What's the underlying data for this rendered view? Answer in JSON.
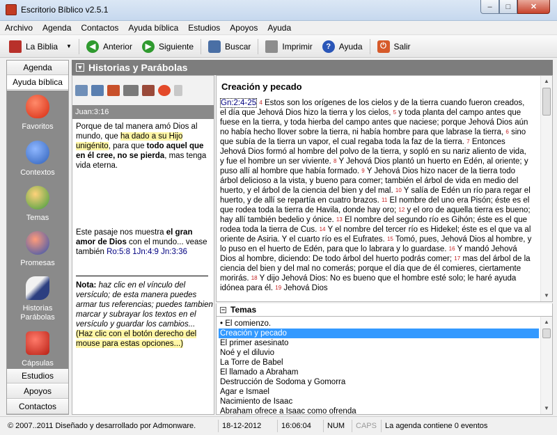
{
  "window": {
    "title": "Escritorio Bíblico v2.5.1",
    "min_glyph": "–",
    "max_glyph": "□",
    "close_glyph": "✕"
  },
  "menu": [
    "Archivo",
    "Agenda",
    "Contactos",
    "Ayuda bíblica",
    "Estudios",
    "Apoyos",
    "Ayuda"
  ],
  "toolbar": {
    "bible": "La Biblia",
    "back": "Anterior",
    "next": "Siguiente",
    "search": "Buscar",
    "print": "Imprimir",
    "help": "Ayuda",
    "exit": "Salir",
    "dropdown_glyph": "▼"
  },
  "leftnav": {
    "top_buttons": [
      "Agenda",
      "Ayuda bíblica"
    ],
    "items": [
      "Favoritos",
      "Contextos",
      "Temas",
      "Promesas",
      "Historias Parábolas",
      "Cápsulas"
    ],
    "bottom_buttons": [
      "Estudios",
      "Apoyos",
      "Contactos"
    ],
    "scroll_glyph": "▼"
  },
  "section": {
    "title": "Historias y Parábolas",
    "chevron": "▼"
  },
  "verse": {
    "ref": "Juan:3:16",
    "t1": "Porque de tal manera amó Dios al mundo, que ",
    "h1": "ha dado a su Hijo unigénito",
    "t2": ", para que ",
    "b1": "todo aquel que en él cree, no se pierda",
    "t3": ", mas tenga vida eterna."
  },
  "note": {
    "t1": "Este pasaje nos muestra ",
    "b1": "el gran amor de Dios",
    "t2": " con el mundo... vease también ",
    "l1": "Ro:5:8",
    "l2": "1Jn:4:9",
    "l3": "Jn:3:36"
  },
  "tip": {
    "label": "Nota:",
    "text": " haz clic en el vínculo del versículo; de esta manera puedes armar tus referencias; puedes tambien marcar y subrayar los textos en el versículo y guardar los cambios...",
    "hl": "(Haz clic con el botón derecho del mouse para estas opciones...)"
  },
  "content": {
    "title": "Creación y pecado",
    "ref": "Gn:2:4-25",
    "verses": [
      {
        "n": "4",
        "t": " Estos son los orígenes de los cielos y de la tierra cuando fueron creados, el día que Jehová Dios hizo la tierra y los cielos, "
      },
      {
        "n": "5",
        "t": " y toda planta del campo antes que fuese en la tierra, y toda hierba del campo antes que naciese; porque Jehová Dios aún no había hecho llover sobre la tierra, ni había hombre para que labrase la tierra, "
      },
      {
        "n": "6",
        "t": " sino que subía de la tierra un vapor, el cual regaba toda la faz de la tierra. "
      },
      {
        "n": "7",
        "t": " Entonces Jehová Dios formó al hombre del polvo de la tierra, y sopló en su nariz aliento de vida, y fue el hombre un ser viviente. "
      },
      {
        "n": "8",
        "t": " Y Jehová Dios plantó un huerto en Edén, al oriente; y puso allí al hombre que había formado. "
      },
      {
        "n": "9",
        "t": " Y Jehová Dios hizo nacer de la tierra todo árbol delicioso a la vista, y bueno para comer; también el árbol de vida en medio del huerto, y el árbol de la ciencia del bien y del mal. "
      },
      {
        "n": "10",
        "t": " Y salía de Edén un río para regar el huerto, y de allí se repartía en cuatro brazos. "
      },
      {
        "n": "11",
        "t": " El nombre del uno era Pisón; éste es el que rodea toda la tierra de Havila, donde hay oro; "
      },
      {
        "n": "12",
        "t": " y el oro de aquella tierra es bueno; hay allí también bedelio y ónice. "
      },
      {
        "n": "13",
        "t": " El nombre del segundo río es Gihón; éste es el que rodea toda la tierra de Cus. "
      },
      {
        "n": "14",
        "t": " Y el nombre del tercer río es Hidekel; éste es el que va al oriente de Asiria. Y el cuarto río es el Eufrates. "
      },
      {
        "n": "15",
        "t": " Tomó, pues, Jehová Dios al hombre, y lo puso en el huerto de Edén, para que lo labrara y lo guardase. "
      },
      {
        "n": "16",
        "t": " Y mandó Jehová Dios al hombre, diciendo: De todo árbol del huerto podrás comer; "
      },
      {
        "n": "17",
        "t": " mas del árbol de la ciencia del bien y del mal no comerás; porque el día que de él comieres, ciertamente morirás. "
      },
      {
        "n": "18",
        "t": " Y dijo Jehová Dios: No es bueno que el hombre esté solo; le haré ayuda idónea para él. "
      },
      {
        "n": "19",
        "t": " Jehová Dios"
      }
    ]
  },
  "temas": {
    "title": "Temas",
    "collapse_glyph": "−",
    "items": [
      "• El comienzo.",
      "Creación y pecado",
      "El primer asesinato",
      "Noé y el diluvio",
      "La Torre de Babel",
      "El llamado a Abraham",
      "Destrucción de Sodoma y Gomorra",
      "Agar e Ismael",
      "Nacimiento de Isaac",
      "Abraham ofrece a Isaac como ofrenda"
    ],
    "selected_index": 1
  },
  "scroll_glyphs": {
    "up": "▲",
    "down": "▼"
  },
  "status": {
    "copyright": "© 2007..2011 Diseñado y desarrollado por Admonware.",
    "date": "18-12-2012",
    "time": "16:06:04",
    "num": "NUM",
    "caps": "CAPS",
    "agenda": "La agenda contiene 0 eventos"
  },
  "colors": {
    "nav_panel": "#8a8a8a",
    "highlight": "#fff6a6",
    "selection": "#3399ff",
    "verse_number": "#c21f1f",
    "link": "#000080"
  }
}
